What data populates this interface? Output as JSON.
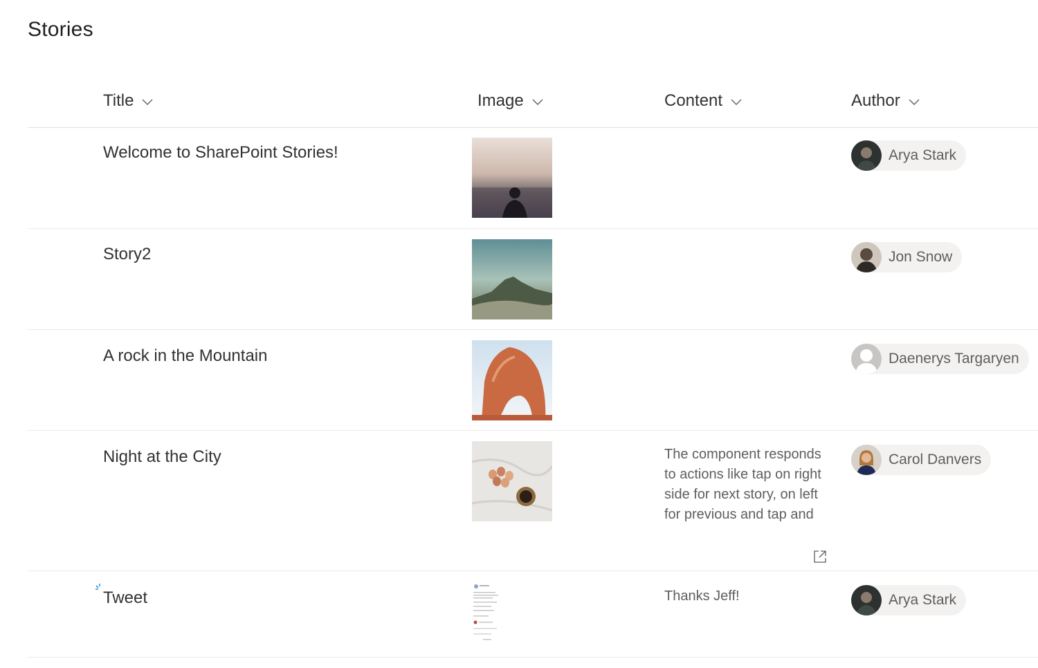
{
  "page": {
    "title": "Stories"
  },
  "columns": [
    {
      "label": "Title"
    },
    {
      "label": "Image"
    },
    {
      "label": "Content"
    },
    {
      "label": "Author"
    }
  ],
  "rows": [
    {
      "title": "Welcome to SharePoint Stories!",
      "image": "person-overlooking-city-photo",
      "content": "",
      "author": "Arya Stark"
    },
    {
      "title": "Story2",
      "image": "mountain-landscape-photo",
      "content": "",
      "author": "Jon Snow"
    },
    {
      "title": "A rock in the Mountain",
      "image": "rock-arch-photo",
      "content": "",
      "author": "Daenerys Targaryen"
    },
    {
      "title": "Night at the City",
      "image": "eggs-and-coffee-photo",
      "content": "The component responds to actions like tap on right side for next story, on left for previous and tap and",
      "author": "Carol Danvers"
    },
    {
      "title": "Tweet",
      "image": "tweet-screenshot-thumbnail",
      "content": "Thanks Jeff!",
      "author": "Arya Stark"
    }
  ],
  "icons": {
    "sort": "chevron-down-icon",
    "open": "open-in-new-window-icon",
    "loading": "loading-spinner-icon",
    "default_avatar": "person-placeholder-icon"
  },
  "colors": {
    "text": "#323130",
    "secondary_text": "#605e5c",
    "persona_bg": "#f3f2f1",
    "divider": "#edebe9",
    "accent": "#0078d4"
  }
}
